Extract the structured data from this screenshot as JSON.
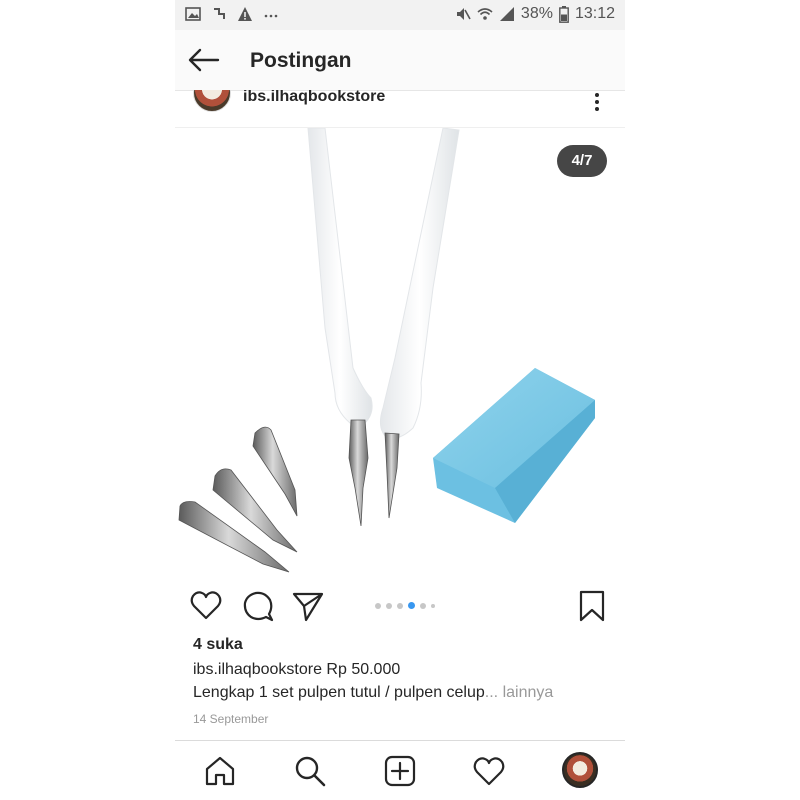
{
  "status_bar": {
    "battery": "38%",
    "time": "13:12",
    "icons": [
      "image-icon",
      "notification-icon",
      "warning-icon",
      "more-dots-icon",
      "mute-icon",
      "wifi-icon",
      "signal-icon",
      "battery-icon"
    ]
  },
  "header": {
    "title": "Postingan"
  },
  "post": {
    "username": "ibs.ilhaqbookstore",
    "counter": "4/7",
    "likes": "4 suka",
    "caption_user": "ibs.ilhaqbookstore",
    "caption_text": " Rp 50.000",
    "description": "Lengkap 1 set pulpen tutul / pulpen celup",
    "more": "... lainnya",
    "date": "14 September",
    "carousel": {
      "total": 7,
      "current": 4
    }
  },
  "colors": {
    "accent": "#3897f0",
    "text": "#262626",
    "muted": "#999999",
    "eraser": "#7ec8e3"
  }
}
